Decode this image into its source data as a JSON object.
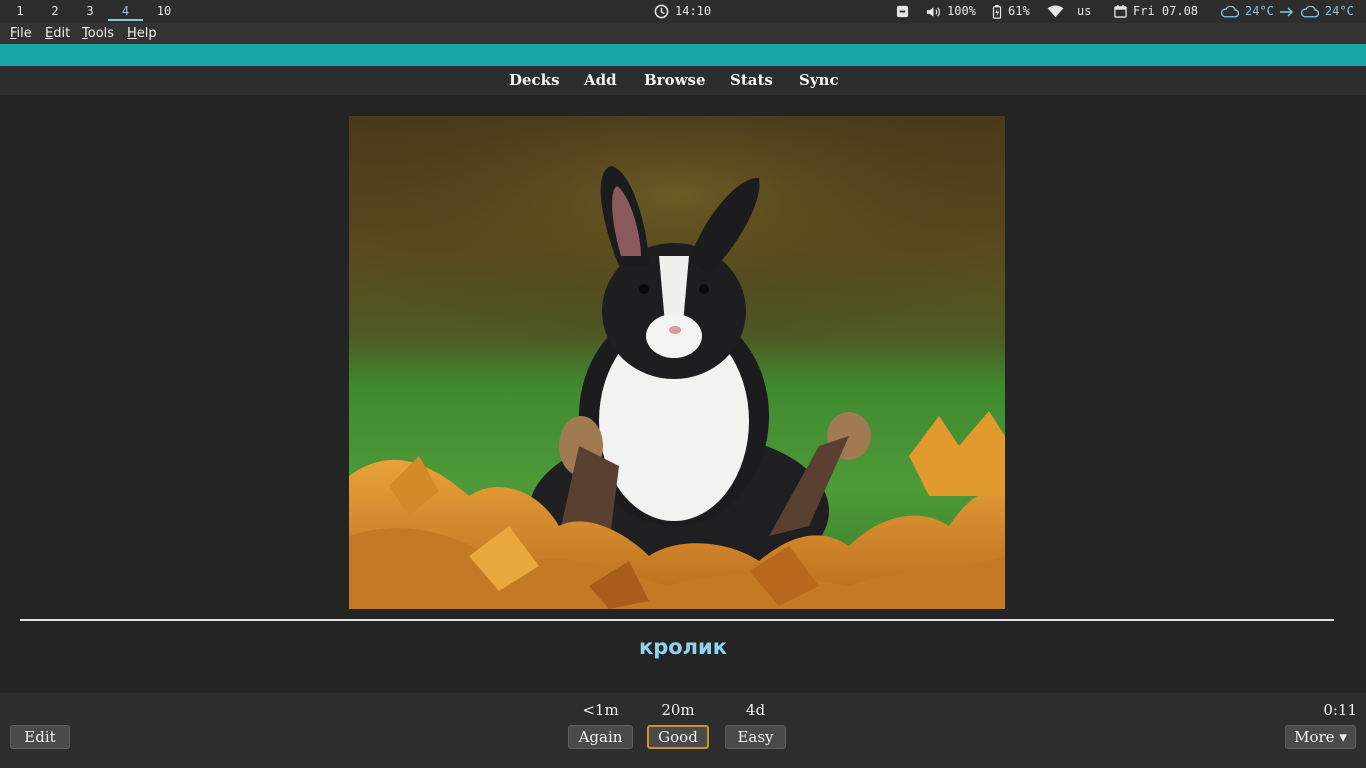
{
  "statusbar": {
    "workspaces": [
      "1",
      "2",
      "3",
      "4",
      "10"
    ],
    "active_workspace": "4",
    "clock": "14:10",
    "volume": "100%",
    "battery": "61%",
    "keyboard_layout": "us",
    "date": "Fri 07.08",
    "weather_now": "24°C",
    "weather_later": "24°C",
    "accent_color": "#7ec8e3"
  },
  "menubar": {
    "items": [
      {
        "underline": "F",
        "rest": "ile"
      },
      {
        "underline": "E",
        "rest": "dit"
      },
      {
        "underline": "T",
        "rest": "ools"
      },
      {
        "underline": "H",
        "rest": "elp"
      }
    ]
  },
  "titlebar": {
    "color": "#1ba6a6"
  },
  "toolbar": {
    "links": [
      "Decks",
      "Add",
      "Browse",
      "Stats",
      "Sync"
    ]
  },
  "card": {
    "image_subject": "rabbit-photo",
    "answer": "кролик",
    "answer_color": "#8fd3ee"
  },
  "bottombar": {
    "edit_label": "Edit",
    "intervals": [
      "<1m",
      "20m",
      "4d"
    ],
    "answer_buttons": [
      "Again",
      "Good",
      "Easy"
    ],
    "default_button_color": "#c9932f",
    "more_label": "More ▾",
    "timer": "0:11"
  }
}
